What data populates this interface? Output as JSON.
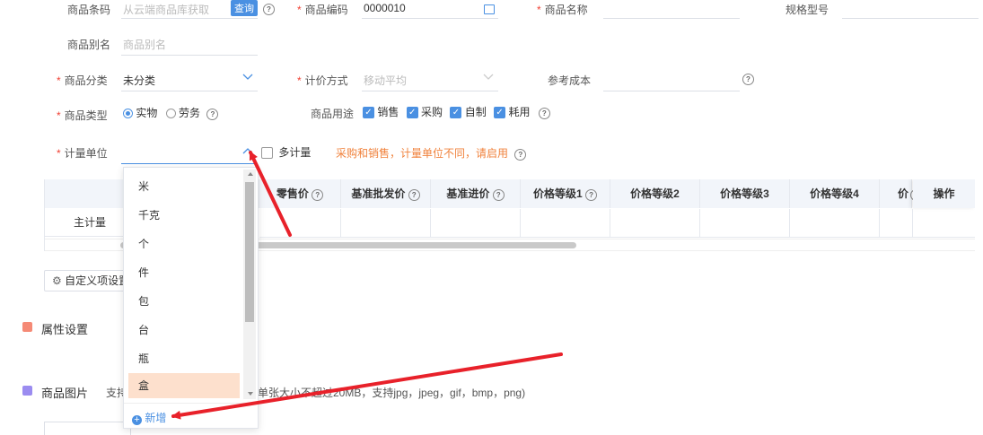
{
  "form": {
    "row1": {
      "barcode_label": "商品条码",
      "barcode_placeholder": "从云端商品库获取",
      "query_button": "查询",
      "code_label": "商品编码",
      "code_value": "0000010",
      "name_label": "商品名称",
      "spec_label": "规格型号"
    },
    "alias_label": "商品别名",
    "alias_placeholder": "商品别名",
    "category_label": "商品分类",
    "category_value": "未分类",
    "pricing_label": "计价方式",
    "pricing_placeholder": "移动平均",
    "ref_cost_label": "参考成本",
    "type_label": "商品类型",
    "type_options": [
      "实物",
      "劳务"
    ],
    "usage_label": "商品用途",
    "usage_options": [
      "销售",
      "采购",
      "自制",
      "耗用"
    ],
    "unit_label": "计量单位",
    "multi_unit_label": "多计量",
    "unit_warning": "采购和销售，计量单位不同，请启用"
  },
  "table": {
    "headers": [
      "零售价",
      "基准批发价",
      "基准进价",
      "价格等级1",
      "价格等级2",
      "价格等级3",
      "价格等级4",
      "价",
      "操作"
    ],
    "row_label": "主计量"
  },
  "custom_button": "自定义项设置",
  "sections": {
    "attr_title": "属性设置",
    "image_title": "商品图片",
    "image_hint_prefix": "支持",
    "image_hint_suffix": "单张大小不超过20MB，支持jpg，jpeg，gif，bmp，png)"
  },
  "dropdown": {
    "items": [
      "米",
      "千克",
      "个",
      "件",
      "包",
      "台",
      "瓶",
      "盒"
    ],
    "add_label": "新增",
    "highlighted": "盒"
  },
  "colors": {
    "primary": "#4a90e2",
    "required": "#f04134",
    "warning": "#f0823c",
    "highlight": "#fde0cd",
    "arrow": "#e8212a"
  }
}
